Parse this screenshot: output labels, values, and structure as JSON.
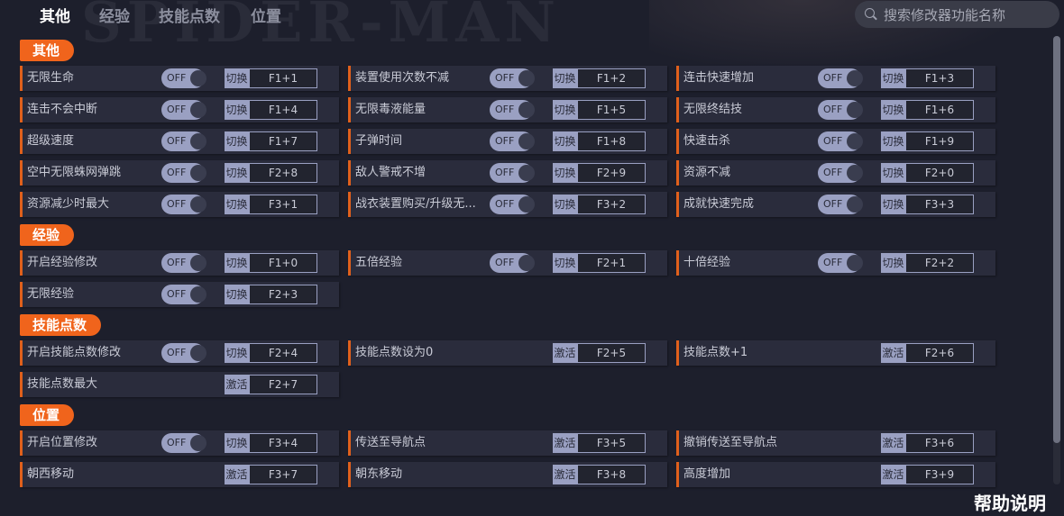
{
  "tabs": [
    "其他",
    "经验",
    "技能点数",
    "位置"
  ],
  "search": {
    "placeholder": "搜索修改器功能名称"
  },
  "sections": [
    {
      "title": "其他",
      "items": [
        {
          "label": "无限生命",
          "toggle": "OFF",
          "action": "切换",
          "key": "F1+1"
        },
        {
          "label": "装置使用次数不减",
          "toggle": "OFF",
          "action": "切换",
          "key": "F1+2"
        },
        {
          "label": "连击快速增加",
          "toggle": "OFF",
          "action": "切换",
          "key": "F1+3"
        },
        {
          "label": "连击不会中断",
          "toggle": "OFF",
          "action": "切换",
          "key": "F1+4"
        },
        {
          "label": "无限毒液能量",
          "toggle": "OFF",
          "action": "切换",
          "key": "F1+5"
        },
        {
          "label": "无限终结技",
          "toggle": "OFF",
          "action": "切换",
          "key": "F1+6"
        },
        {
          "label": "超级速度",
          "toggle": "OFF",
          "action": "切换",
          "key": "F1+7"
        },
        {
          "label": "子弹时间",
          "toggle": "OFF",
          "action": "切换",
          "key": "F1+8"
        },
        {
          "label": "快速击杀",
          "toggle": "OFF",
          "action": "切换",
          "key": "F1+9"
        },
        {
          "label": "空中无限蛛网弹跳",
          "toggle": "OFF",
          "action": "切换",
          "key": "F2+8"
        },
        {
          "label": "敌人警戒不增",
          "toggle": "OFF",
          "action": "切换",
          "key": "F2+9"
        },
        {
          "label": "资源不减",
          "toggle": "OFF",
          "action": "切换",
          "key": "F2+0"
        },
        {
          "label": "资源减少时最大",
          "toggle": "OFF",
          "action": "切换",
          "key": "F3+1"
        },
        {
          "label": "战衣装置购买/升级无...",
          "toggle": "OFF",
          "action": "切换",
          "key": "F3+2"
        },
        {
          "label": "成就快速完成",
          "toggle": "OFF",
          "action": "切换",
          "key": "F3+3"
        }
      ]
    },
    {
      "title": "经验",
      "items": [
        {
          "label": "开启经验修改",
          "toggle": "OFF",
          "action": "切换",
          "key": "F1+0"
        },
        {
          "label": "五倍经验",
          "toggle": "OFF",
          "action": "切换",
          "key": "F2+1"
        },
        {
          "label": "十倍经验",
          "toggle": "OFF",
          "action": "切换",
          "key": "F2+2"
        },
        {
          "label": "无限经验",
          "toggle": "OFF",
          "action": "切换",
          "key": "F2+3"
        }
      ]
    },
    {
      "title": "技能点数",
      "items": [
        {
          "label": "开启技能点数修改",
          "toggle": "OFF",
          "action": "切换",
          "key": "F2+4"
        },
        {
          "label": "技能点数设为0",
          "toggle": null,
          "action": "激活",
          "key": "F2+5"
        },
        {
          "label": "技能点数+1",
          "toggle": null,
          "action": "激活",
          "key": "F2+6"
        },
        {
          "label": "技能点数最大",
          "toggle": null,
          "action": "激活",
          "key": "F2+7"
        }
      ]
    },
    {
      "title": "位置",
      "items": [
        {
          "label": "开启位置修改",
          "toggle": "OFF",
          "action": "切换",
          "key": "F3+4"
        },
        {
          "label": "传送至导航点",
          "toggle": null,
          "action": "激活",
          "key": "F3+5"
        },
        {
          "label": "撤销传送至导航点",
          "toggle": null,
          "action": "激活",
          "key": "F3+6"
        },
        {
          "label": "朝西移动",
          "toggle": null,
          "action": "激活",
          "key": "F3+7"
        },
        {
          "label": "朝东移动",
          "toggle": null,
          "action": "激活",
          "key": "F3+8"
        },
        {
          "label": "高度增加",
          "toggle": null,
          "action": "激活",
          "key": "F3+9"
        }
      ]
    }
  ],
  "help_label": "帮助说明",
  "colors": {
    "accent": "#f0641c",
    "background": "#1d1f2c",
    "row": "#2a2c3c",
    "toggle": "#9aa0c2"
  }
}
